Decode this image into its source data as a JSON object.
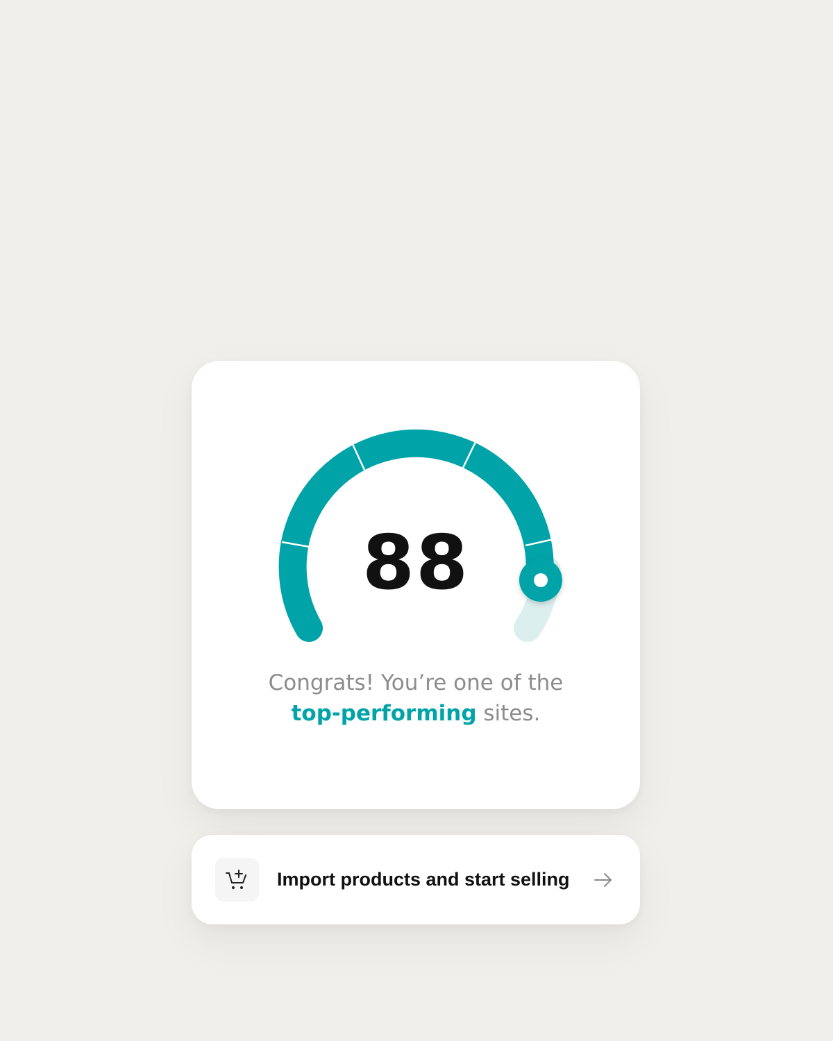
{
  "score_card": {
    "score": "88",
    "message_prefix": "Congrats! You’re one of the",
    "message_highlight": "top-performing",
    "message_suffix": " sites.",
    "gauge": {
      "level_percent": 88,
      "accent_color": "#00a3a8",
      "track_color": "#dcefef",
      "segments": 5
    }
  },
  "action_card": {
    "label": "Import products and start selling",
    "icon": "cart-plus-icon",
    "arrow_icon": "arrow-right-icon"
  }
}
